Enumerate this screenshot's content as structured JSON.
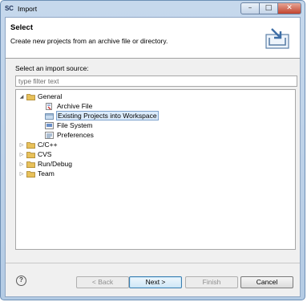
{
  "window": {
    "app_icon": "SC",
    "title": "Import",
    "min_label": "–",
    "max_label": "□",
    "close_label": "✕"
  },
  "banner": {
    "title": "Select",
    "description": "Create new projects from an archive file or directory.",
    "icon": "import-wizard-icon"
  },
  "source_label": "Select an import source:",
  "filter": {
    "placeholder": "type filter text",
    "value": ""
  },
  "tree": {
    "nodes": [
      {
        "label": "General",
        "expanded": true,
        "icon": "folder-icon"
      },
      {
        "label": "Archive File",
        "icon": "archive-file-icon"
      },
      {
        "label": "Existing Projects into Workspace",
        "icon": "project-icon",
        "selected": true
      },
      {
        "label": "File System",
        "icon": "file-system-icon"
      },
      {
        "label": "Preferences",
        "icon": "preferences-icon"
      },
      {
        "label": "C/C++",
        "expanded": false,
        "icon": "folder-icon"
      },
      {
        "label": "CVS",
        "expanded": false,
        "icon": "folder-icon"
      },
      {
        "label": "Run/Debug",
        "expanded": false,
        "icon": "folder-icon"
      },
      {
        "label": "Team",
        "expanded": false,
        "icon": "folder-icon"
      }
    ]
  },
  "buttons": {
    "help": "?",
    "back": "< Back",
    "next": "Next >",
    "finish": "Finish",
    "cancel": "Cancel"
  },
  "colors": {
    "selection_bg": "#dcecfc",
    "selection_border": "#7da2ce",
    "folder": "#e8c15a",
    "title_bar": "#c6d8ec"
  }
}
